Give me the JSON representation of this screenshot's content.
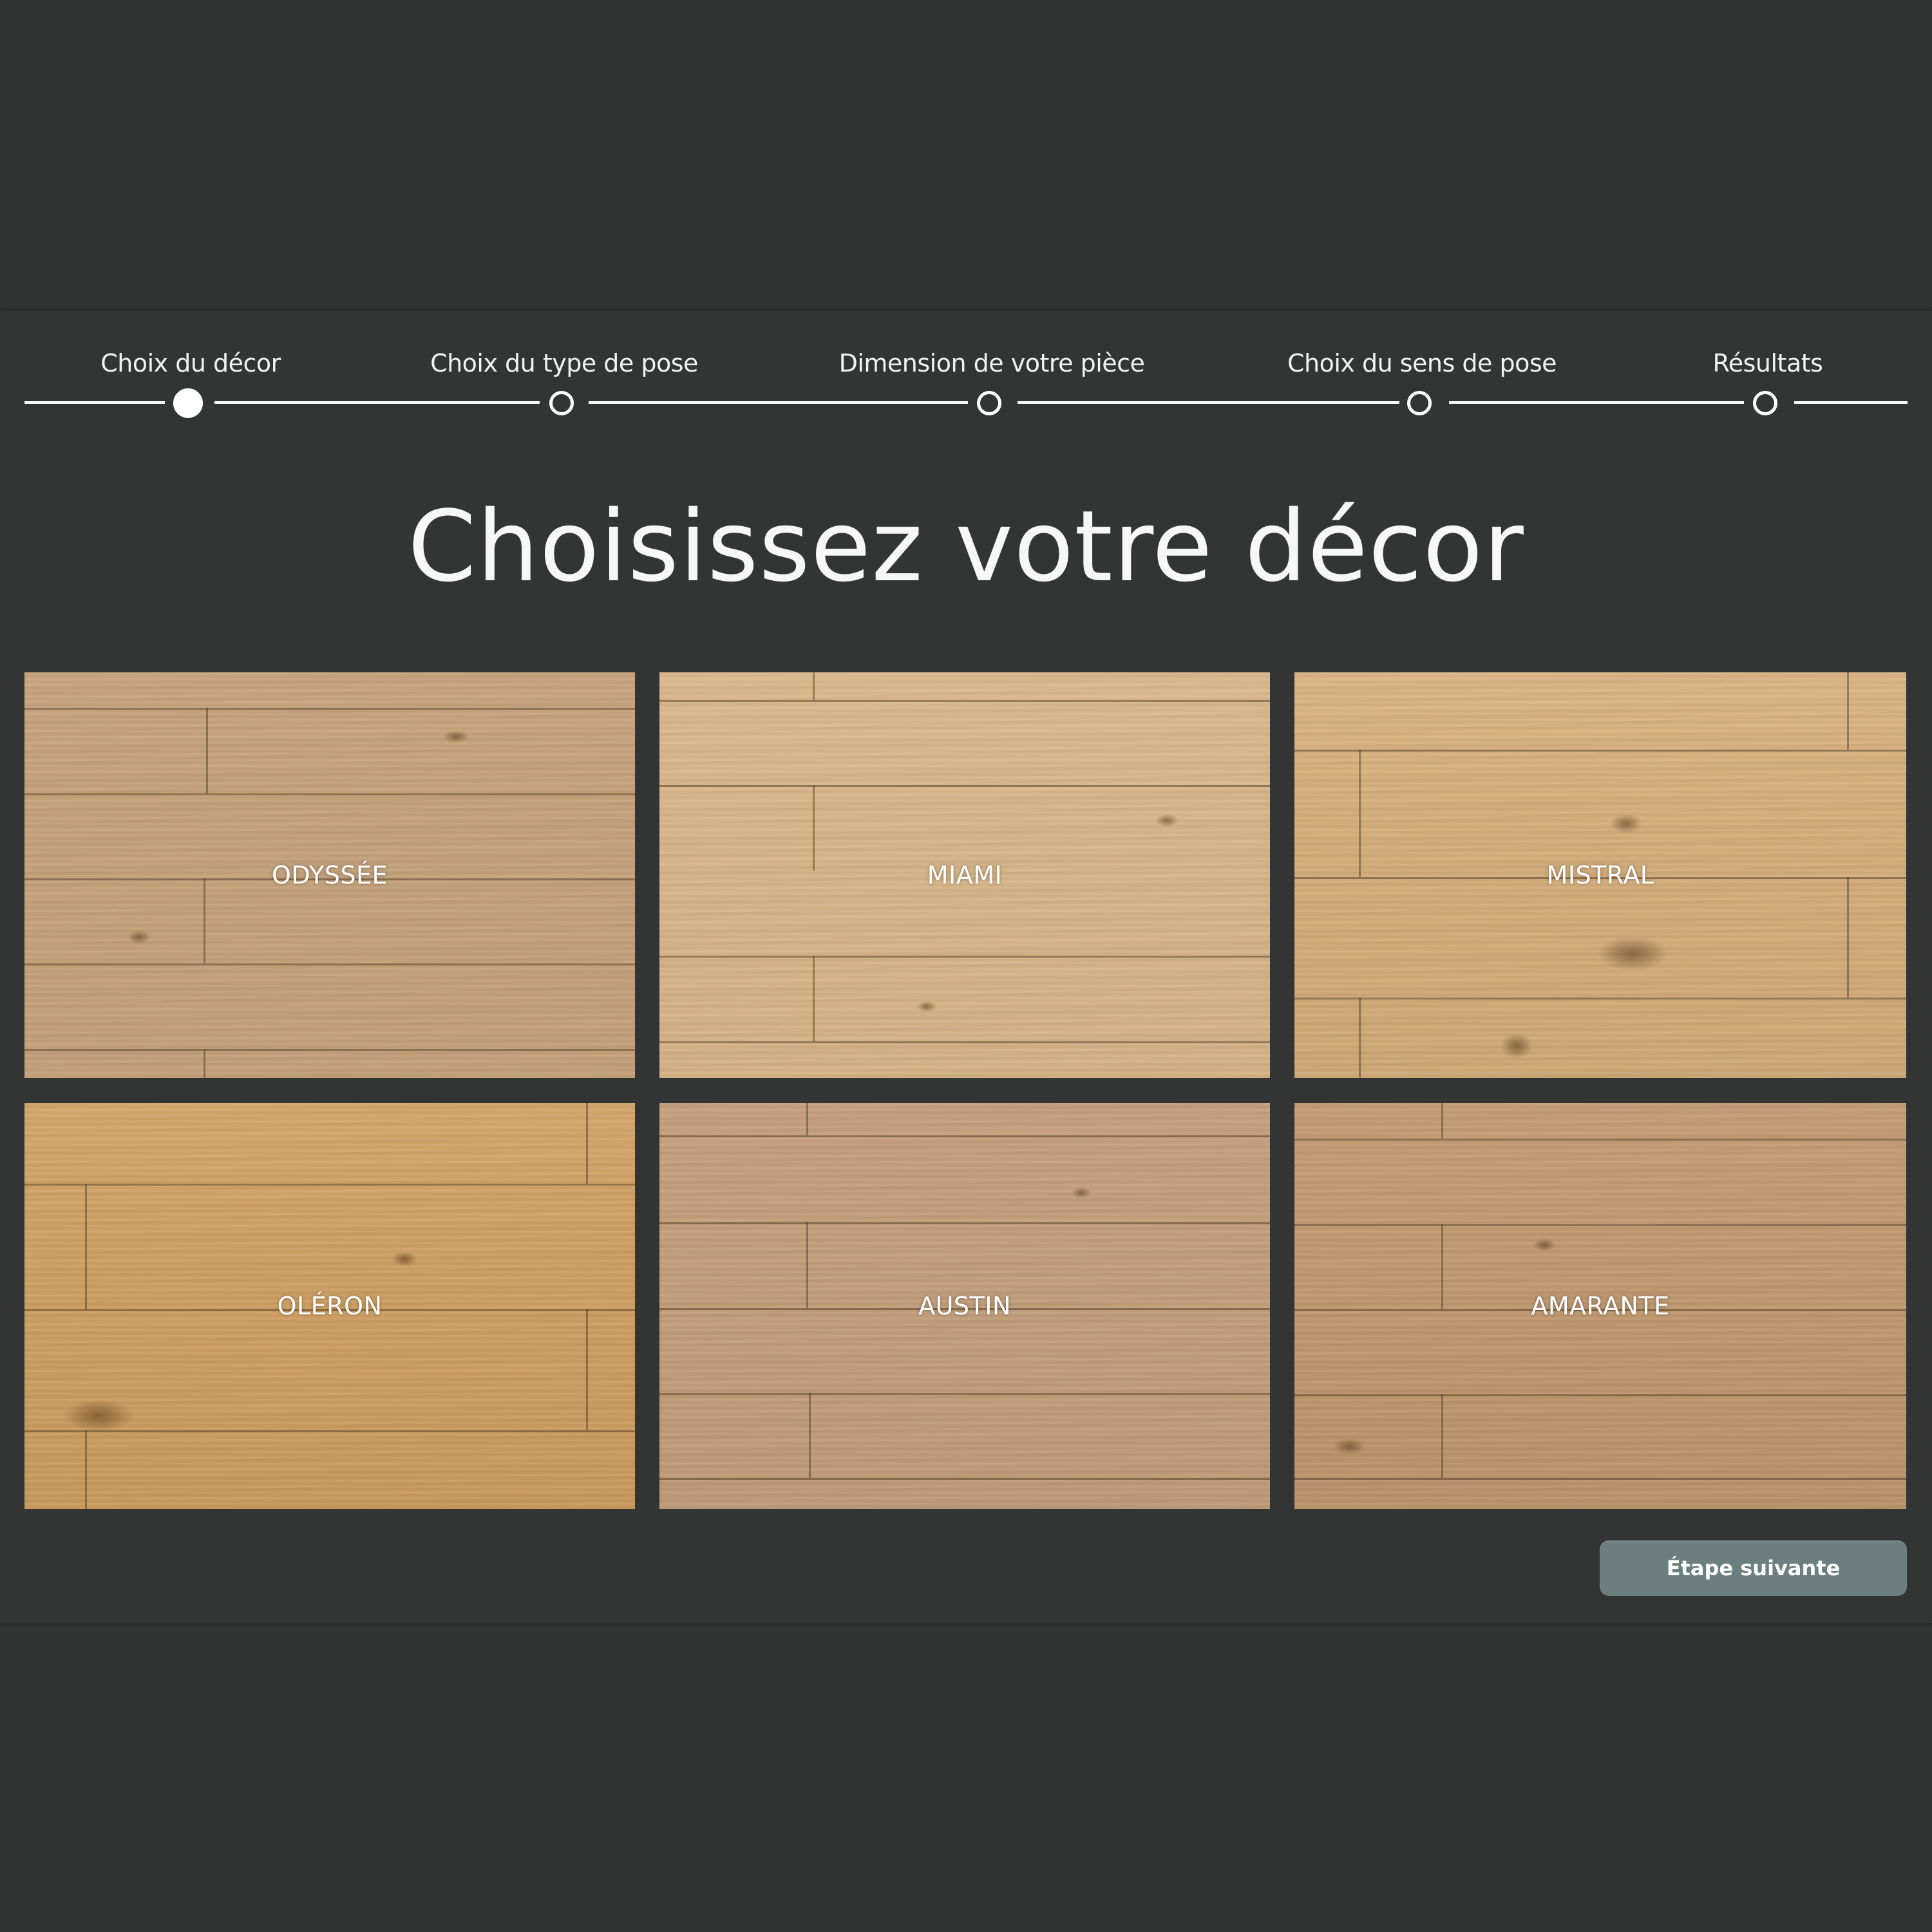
{
  "stepper": {
    "steps": [
      {
        "label": "Choix du décor",
        "active": true
      },
      {
        "label": "Choix du type de pose",
        "active": false
      },
      {
        "label": "Dimension de votre pièce",
        "active": false
      },
      {
        "label": "Choix du sens de pose",
        "active": false
      },
      {
        "label": "Résultats",
        "active": false
      }
    ]
  },
  "heading": "Choisissez votre décor",
  "decors": [
    {
      "name": "ODYSSÉE"
    },
    {
      "name": "MIAMI"
    },
    {
      "name": "MISTRAL"
    },
    {
      "name": "OLÉRON"
    },
    {
      "name": "AUSTIN"
    },
    {
      "name": "AMARANTE"
    }
  ],
  "actions": {
    "next_label": "Étape suivante"
  },
  "colors": {
    "background": "#323333",
    "button": "#6b7f7f",
    "text": "#ffffff"
  }
}
